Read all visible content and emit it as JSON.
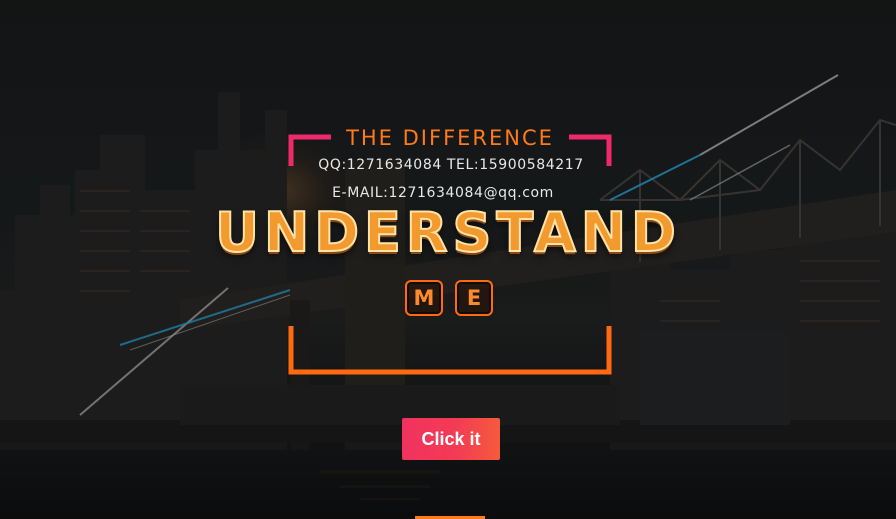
{
  "hero": {
    "eyebrow": "THE DIFFERENCE",
    "contact_qq": "QQ:1271634084 TEL:15900584217",
    "contact_email": "E-MAIL:1271634084@qq.com",
    "headline": "UNDERSTAND",
    "sub_letters": [
      "M",
      "E"
    ],
    "cta_label": "Click it"
  },
  "colors": {
    "accent_orange": "#ff7a1a",
    "accent_pink": "#ee2a6b",
    "cta_gradient_start": "#f0335e",
    "cta_gradient_end": "#f65a3c",
    "line_cyan": "#2aa8d8"
  },
  "icons": {
    "background": "city-bridge-night-image"
  }
}
